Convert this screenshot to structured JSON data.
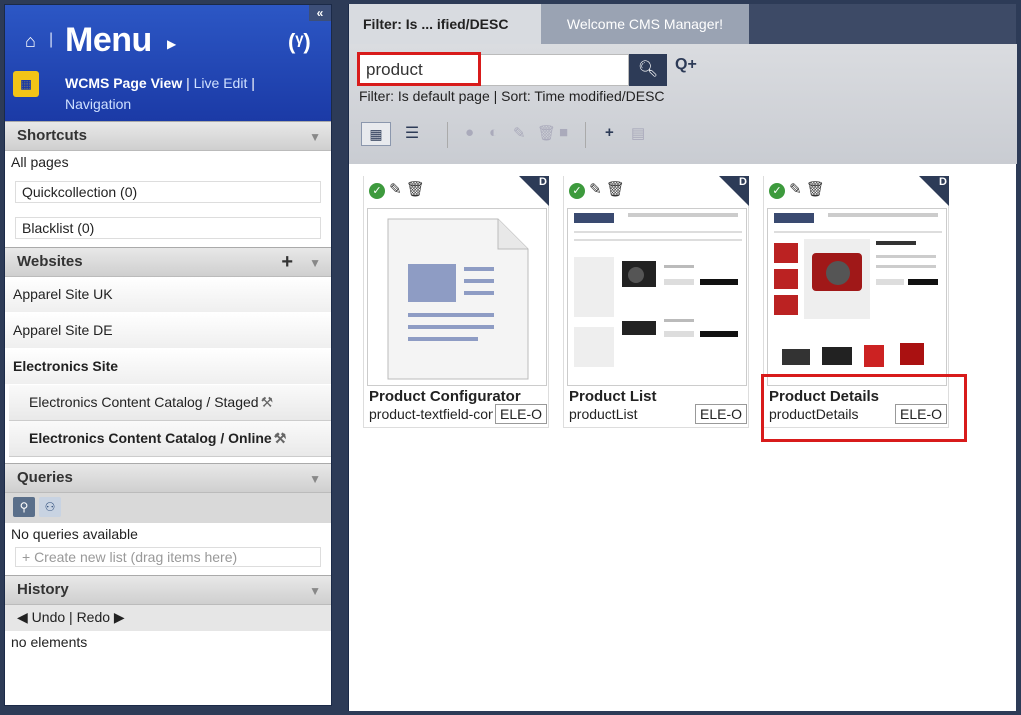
{
  "sidebar": {
    "collapse_label": "«",
    "menu_title": "Menu",
    "logo_glyph": "(ᵞ)",
    "view": {
      "active": "WCMS Page View",
      "live_edit": "Live Edit",
      "navigation": "Navigation",
      "sep": "|"
    },
    "shortcuts": {
      "title": "Shortcuts",
      "all_pages": "All pages",
      "quickcollection": "Quickcollection (0)",
      "blacklist": "Blacklist (0)"
    },
    "websites": {
      "title": "Websites",
      "sites": [
        "Apparel Site UK",
        "Apparel Site DE",
        "Electronics Site"
      ],
      "catalogs": [
        "Electronics Content Catalog / Staged",
        "Electronics Content Catalog / Online"
      ]
    },
    "queries": {
      "title": "Queries",
      "empty": "No queries available",
      "create": "+ Create new list (drag items here)"
    },
    "history": {
      "title": "History",
      "undo": "Undo",
      "redo": "Redo",
      "empty": "no elements"
    }
  },
  "tabs": [
    {
      "label": "Filter: Is ... ified/DESC"
    },
    {
      "label": "Welcome CMS Manager!"
    }
  ],
  "search": {
    "value": "product",
    "filter_text": "Filter: Is default page | Sort: Time modified/DESC"
  },
  "cards": [
    {
      "name": "Product Configurator",
      "uid": "product-textfield-configurator",
      "catalog": "ELE-O",
      "badge": "D"
    },
    {
      "name": "Product List",
      "uid": "productList",
      "catalog": "ELE-O",
      "badge": "D"
    },
    {
      "name": "Product Details",
      "uid": "productDetails",
      "catalog": "ELE-O",
      "badge": "D"
    }
  ],
  "colors": {
    "sidebar_blue": "#1b3aa6",
    "highlight": "#d81b1b",
    "dark_navy": "#2d3b57"
  }
}
